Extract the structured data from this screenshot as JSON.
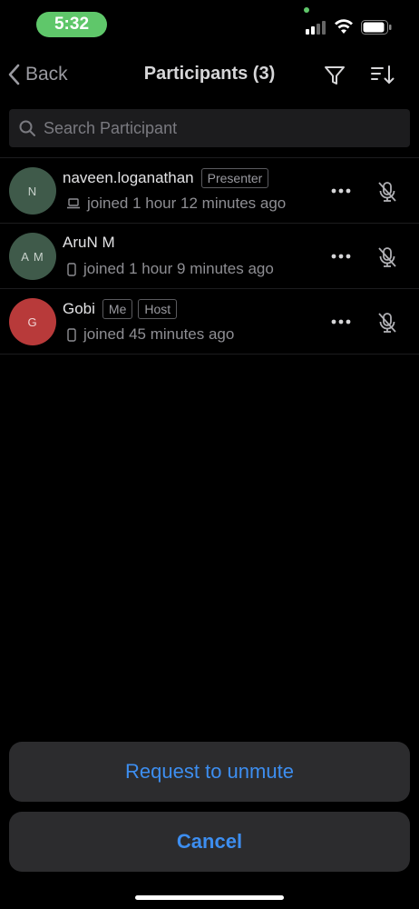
{
  "status_bar": {
    "time": "5:32"
  },
  "nav": {
    "back_label": "Back",
    "title": "Participants (3)"
  },
  "search": {
    "placeholder": "Search Participant",
    "value": ""
  },
  "participants": [
    {
      "initials": "N",
      "name": "naveen.loganathan",
      "tags": [
        "Presenter"
      ],
      "device": "laptop-icon",
      "joined": "joined 1 hour 12 minutes ago",
      "avatar_color": "#3f5a4a",
      "muted": true
    },
    {
      "initials": "A M",
      "name": "AruN M",
      "tags": [],
      "device": "phone-icon",
      "joined": "joined 1 hour 9 minutes ago",
      "avatar_color": "#3f5a4a",
      "muted": true
    },
    {
      "initials": "G",
      "name": "Gobi",
      "tags": [
        "Me",
        "Host"
      ],
      "device": "phone-icon",
      "joined": "joined 45 minutes ago",
      "avatar_color": "#b83a3a",
      "muted": true
    }
  ],
  "actions": {
    "request_unmute": "Request to unmute",
    "cancel": "Cancel"
  },
  "colors": {
    "accent": "#3d8ef0",
    "background": "#000000",
    "sheet": "#2c2c2e",
    "status_green": "#5fc76a"
  }
}
